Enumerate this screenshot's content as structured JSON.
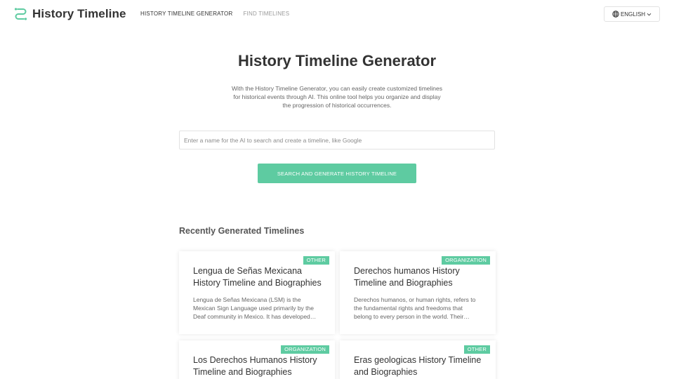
{
  "header": {
    "logo_text": "History Timeline",
    "nav": [
      {
        "label": "HISTORY TIMELINE GENERATOR"
      },
      {
        "label": "FIND TIMELINES"
      }
    ],
    "language": {
      "label": "ENGLISH",
      "icon": "globe-icon",
      "chevron": "chevron-down-icon"
    }
  },
  "hero": {
    "title": "History Timeline Generator",
    "description": "With the History Timeline Generator, you can easily create customized timelines for historical events through AI. This online tool helps you organize and display the progression of historical occurrences.",
    "search": {
      "placeholder": "Enter a name for the AI to search and create a timeline, like Google",
      "value": ""
    },
    "button_label": "SEARCH AND GENERATE HISTORY TIMELINE"
  },
  "recent": {
    "title": "Recently Generated Timelines",
    "cards": [
      {
        "badge": "OTHER",
        "title": "Lengua de Señas Mexicana History Timeline and Biographies",
        "description": "Lengua de Señas Mexicana (LSM) is the Mexican Sign Language used primarily by the Deaf community in Mexico. It has developed over the years."
      },
      {
        "badge": "ORGANIZATION",
        "title": "Derechos humanos History Timeline and Biographies",
        "description": "Derechos humanos, or human rights, refers to the fundamental rights and freedoms that belong to every person in the world. Their history is marked by struggle."
      },
      {
        "badge": "ORGANIZATION",
        "title": "Los Derechos Humanos History Timeline and Biographies",
        "description": ""
      },
      {
        "badge": "OTHER",
        "title": "Eras geologicas History Timeline and Biographies",
        "description": ""
      }
    ]
  },
  "colors": {
    "accent": "#5ecba1",
    "text": "#333333",
    "muted": "#9a9a9a"
  }
}
